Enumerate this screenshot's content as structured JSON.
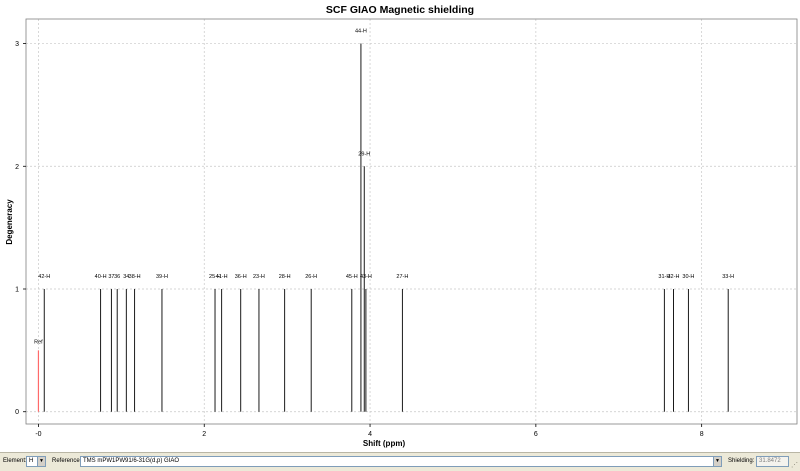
{
  "chart_data": {
    "type": "bar",
    "title": "SCF GIAO Magnetic shielding",
    "xlabel": "Shift (ppm)",
    "ylabel": "Degeneracy",
    "xlim": [
      -0.15,
      9.15
    ],
    "ylim": [
      -0.1,
      3.2
    ],
    "x_ticks": [
      0,
      2,
      4,
      6,
      8
    ],
    "x_tick_labels": [
      "-0",
      "2",
      "4",
      "6",
      "8"
    ],
    "y_ticks": [
      0,
      1,
      2,
      3
    ],
    "y_tick_labels": [
      "0",
      "1",
      "2",
      "3"
    ],
    "reference": {
      "label": "Ref",
      "x": 0.0,
      "y": 0.5,
      "color": "#ff6a6a"
    },
    "peaks": [
      {
        "label": "42-H",
        "x": 0.07,
        "y": 1
      },
      {
        "label": "40-H",
        "x": 0.75,
        "y": 1
      },
      {
        "label": "37",
        "x": 0.88,
        "y": 1
      },
      {
        "label": "36",
        "x": 0.95,
        "y": 1
      },
      {
        "label": "34",
        "x": 1.06,
        "y": 1
      },
      {
        "label": "38-H",
        "x": 1.16,
        "y": 1
      },
      {
        "label": "39-H",
        "x": 1.49,
        "y": 1
      },
      {
        "label": "25-H",
        "x": 2.13,
        "y": 1
      },
      {
        "label": "41-H",
        "x": 2.21,
        "y": 1
      },
      {
        "label": "36-H",
        "x": 2.44,
        "y": 1
      },
      {
        "label": "23-H",
        "x": 2.66,
        "y": 1
      },
      {
        "label": "28-H",
        "x": 2.97,
        "y": 1
      },
      {
        "label": "26-H",
        "x": 3.29,
        "y": 1
      },
      {
        "label": "45-H",
        "x": 3.78,
        "y": 1
      },
      {
        "label": "44-H",
        "x": 3.89,
        "y": 3
      },
      {
        "label": "29-H",
        "x": 3.93,
        "y": 2
      },
      {
        "label": "43-H",
        "x": 3.95,
        "y": 1
      },
      {
        "label": "27-H",
        "x": 4.39,
        "y": 1
      },
      {
        "label": "31-H",
        "x": 7.55,
        "y": 1
      },
      {
        "label": "32-H",
        "x": 7.66,
        "y": 1
      },
      {
        "label": "30-H",
        "x": 7.84,
        "y": 1
      },
      {
        "label": "33-H",
        "x": 8.32,
        "y": 1
      }
    ],
    "grid": true,
    "bar_color": "#000000",
    "grid_color": "#c8c8c8"
  },
  "controls": {
    "element_label": "Element:",
    "element_value": "H",
    "reference_label": "Reference:",
    "reference_value": "TMS mPW1PW91/6-31G(d,p) GIAO",
    "shielding_label": "Shielding:",
    "shielding_value": "31.8472",
    "dropdown_glyph": "▼",
    "grip_glyph": "⋰"
  }
}
